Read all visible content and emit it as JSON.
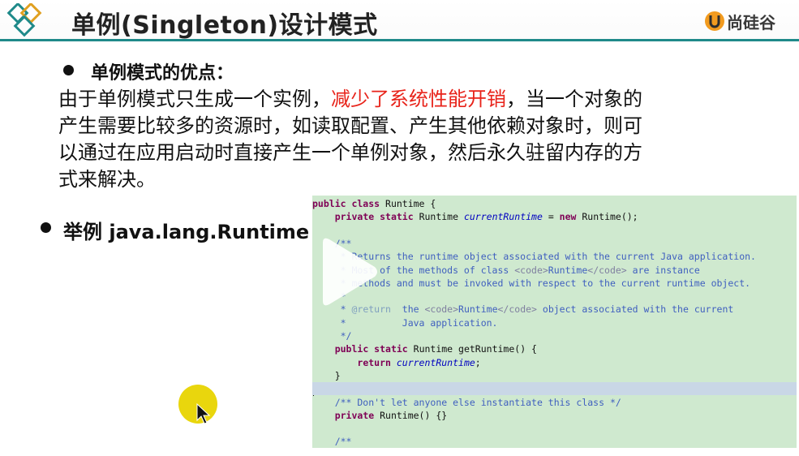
{
  "header": {
    "title": "单例(Singleton)设计模式",
    "brand_text": "尚硅谷"
  },
  "advantages": {
    "heading": "单例模式的优点：",
    "line1_pre": "由于单例模式只生成一个实例，",
    "line1_red": "减少了系统性能开销",
    "line1_post": "，当一个对象的",
    "line2": "产生需要比较多的资源时，如读取配置、产生其他依赖对象时，则可",
    "line3": "以通过在应用启动时直接产生一个单例对象，然后永久驻留内存的方",
    "line4": "式来解决。"
  },
  "example": {
    "label": "举例 java.lang.Runtime"
  },
  "code": [
    [
      [
        "kw",
        "public class "
      ],
      [
        "",
        "Runtime {"
      ]
    ],
    [
      [
        "",
        "    "
      ],
      [
        "kw",
        "private static "
      ],
      [
        "",
        "Runtime "
      ],
      [
        "it",
        "currentRuntime"
      ],
      [
        "",
        " = "
      ],
      [
        "kw",
        "new "
      ],
      [
        "",
        "Runtime();"
      ]
    ],
    [
      [
        "",
        ""
      ]
    ],
    [
      [
        "cm",
        "    /**"
      ]
    ],
    [
      [
        "cm",
        "     * Returns the runtime object associated with the current Java application."
      ]
    ],
    [
      [
        "cm",
        "     * Most of the methods of class "
      ],
      [
        "tag",
        "<code>"
      ],
      [
        "cm",
        "Runtime"
      ],
      [
        "tag",
        "</code>"
      ],
      [
        "cm",
        " are instance"
      ]
    ],
    [
      [
        "cm",
        "     * methods and must be invoked with respect to the current runtime object."
      ]
    ],
    [
      [
        "cm",
        "     *"
      ]
    ],
    [
      [
        "cm",
        "     * "
      ],
      [
        "ann",
        "@return"
      ],
      [
        "cm",
        "  the "
      ],
      [
        "tag",
        "<code>"
      ],
      [
        "cm",
        "Runtime"
      ],
      [
        "tag",
        "</code>"
      ],
      [
        "cm",
        " object associated with the current"
      ]
    ],
    [
      [
        "cm",
        "     *          Java application."
      ]
    ],
    [
      [
        "cm",
        "     */"
      ]
    ],
    [
      [
        "",
        "    "
      ],
      [
        "kw",
        "public static "
      ],
      [
        "",
        "Runtime getRuntime() {"
      ]
    ],
    [
      [
        "",
        "        "
      ],
      [
        "kw",
        "return "
      ],
      [
        "it",
        "currentRuntime"
      ],
      [
        "",
        ";"
      ]
    ],
    [
      [
        "",
        "    }"
      ]
    ],
    [
      [
        "",
        ""
      ]
    ],
    [
      [
        "cm",
        "    /** Don't let anyone else instantiate this class */"
      ]
    ],
    [
      [
        "",
        "    "
      ],
      [
        "kw",
        "private "
      ],
      [
        "",
        "Runtime() {}"
      ]
    ],
    [
      [
        "",
        ""
      ]
    ],
    [
      [
        "cm",
        "    /**"
      ]
    ]
  ],
  "highlighted_line_index": 14,
  "colors": {
    "header_rule": "#1f8a8a",
    "code_background": "#cfe9cf",
    "code_highlight": "#c9d7e6",
    "emphasis_red": "#e8231a",
    "brand_orange": "#f29b1f"
  },
  "icons": {
    "logo": "interlocking-diamonds-icon",
    "brand": "u-logo-icon",
    "overlay": "play-icon",
    "cursor": "mouse-pointer-icon"
  }
}
